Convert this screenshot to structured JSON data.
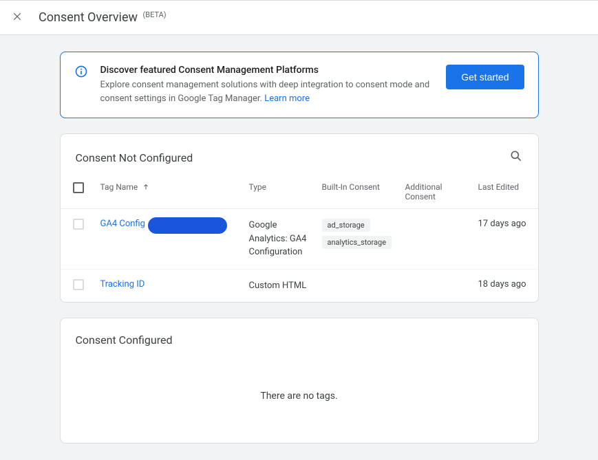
{
  "header": {
    "title": "Consent Overview",
    "beta": "(BETA)"
  },
  "banner": {
    "title": "Discover featured Consent Management Platforms",
    "desc_prefix": "Explore consent management solutions with deep integration to consent mode and consent settings in Google Tag Manager. ",
    "learn_more": "Learn more",
    "cta": "Get started"
  },
  "sections": {
    "not_configured": {
      "title": "Consent Not Configured",
      "columns": {
        "tag_name": "Tag Name",
        "type": "Type",
        "builtin": "Built-In Consent",
        "additional": "Additional Consent",
        "edited": "Last Edited"
      },
      "rows": [
        {
          "name": "GA4 Config",
          "redacted": true,
          "type": "Google Analytics: GA4 Configuration",
          "builtin": [
            "ad_storage",
            "analytics_storage"
          ],
          "edited": "17 days ago"
        },
        {
          "name": "Tracking ID",
          "redacted": false,
          "type": "Custom HTML",
          "builtin": [],
          "edited": "18 days ago"
        }
      ]
    },
    "configured": {
      "title": "Consent Configured",
      "empty_text": "There are no tags."
    }
  }
}
